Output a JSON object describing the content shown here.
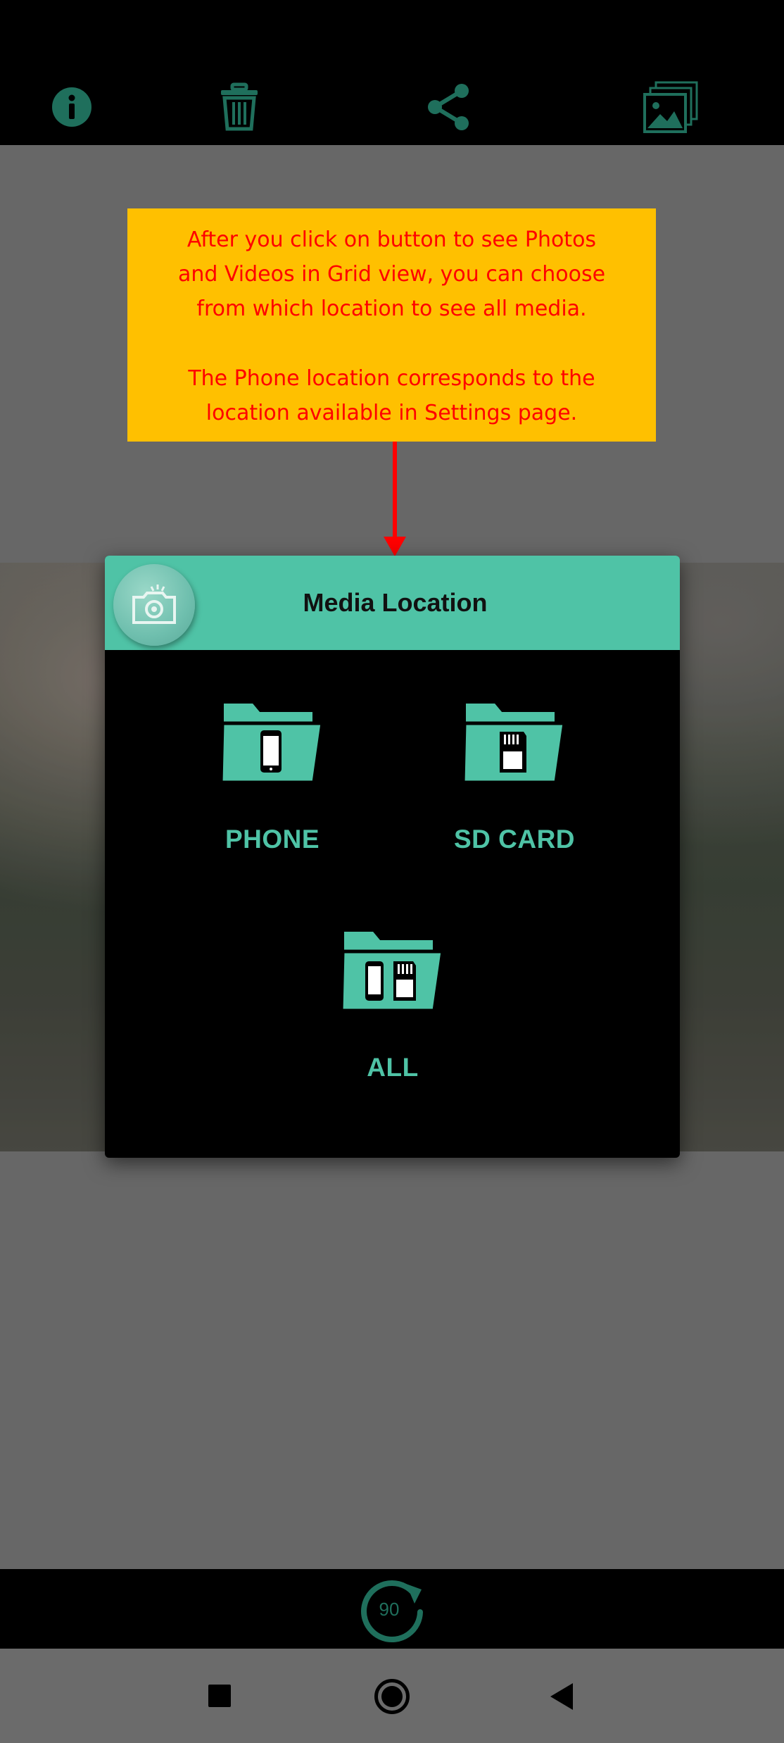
{
  "toolbar": {
    "icons": [
      "info-icon",
      "trash-icon",
      "share-icon",
      "gallery-grid-icon"
    ],
    "icon_color": "#1f6f5c"
  },
  "annotation": {
    "line1": "After you click on button to see Photos",
    "line2": "and Videos in Grid view, you can choose",
    "line3": "from which location to see all media.",
    "line4": "The Phone location corresponds to the",
    "line5": "location available in Settings page.",
    "background": "#ffc000",
    "text_color": "#ff0000"
  },
  "dialog": {
    "title": "Media Location",
    "header_color": "#4fc3a6",
    "options": [
      {
        "label": "PHONE",
        "icon": "phone-folder-icon"
      },
      {
        "label": "SD CARD",
        "icon": "sd-card-folder-icon"
      },
      {
        "label": "ALL",
        "icon": "all-folder-icon"
      }
    ]
  },
  "bottom_bar": {
    "rotate_label": "90"
  },
  "navbar": {
    "buttons": [
      "recent-apps",
      "home",
      "back"
    ]
  }
}
